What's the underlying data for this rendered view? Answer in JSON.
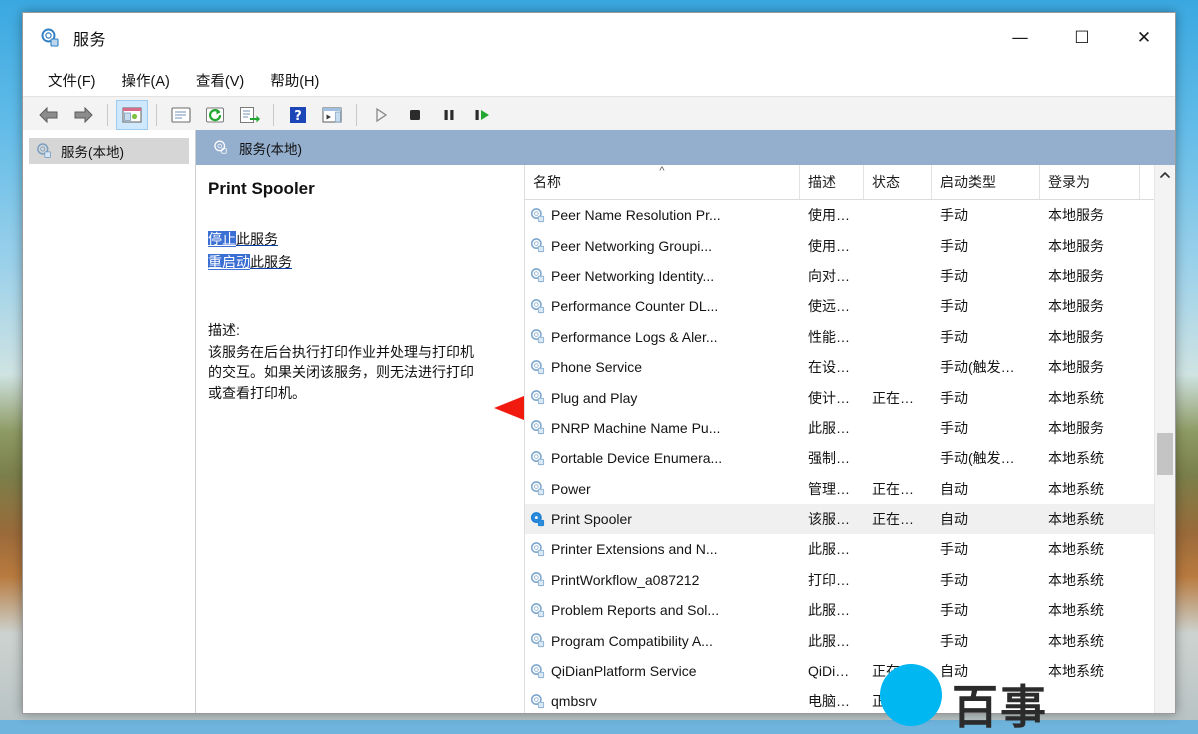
{
  "window": {
    "title": "服务",
    "app_icon": "services-gear-icon",
    "controls": {
      "minimize": "—",
      "maximize": "☐",
      "close": "✕",
      "minimize_name": "minimize-button",
      "maximize_name": "maximize-button",
      "close_name": "close-button"
    }
  },
  "menubar": {
    "items": [
      {
        "label": "文件(F)",
        "name": "menu-file"
      },
      {
        "label": "操作(A)",
        "name": "menu-action"
      },
      {
        "label": "查看(V)",
        "name": "menu-view"
      },
      {
        "label": "帮助(H)",
        "name": "menu-help"
      }
    ]
  },
  "toolbar": {
    "buttons": [
      {
        "name": "back-icon",
        "kind": "back"
      },
      {
        "name": "forward-icon",
        "kind": "forward"
      },
      {
        "name": "separator",
        "kind": "sep"
      },
      {
        "name": "show-hide-console-tree-icon",
        "kind": "tree",
        "active": true
      },
      {
        "name": "separator",
        "kind": "sep"
      },
      {
        "name": "properties-icon",
        "kind": "properties"
      },
      {
        "name": "refresh-icon",
        "kind": "refresh"
      },
      {
        "name": "export-list-icon",
        "kind": "export"
      },
      {
        "name": "separator",
        "kind": "sep"
      },
      {
        "name": "help-icon",
        "kind": "help"
      },
      {
        "name": "show-action-pane-icon",
        "kind": "actionpane"
      },
      {
        "name": "separator",
        "kind": "sep"
      },
      {
        "name": "start-service-icon",
        "kind": "play"
      },
      {
        "name": "stop-service-icon",
        "kind": "stop"
      },
      {
        "name": "pause-service-icon",
        "kind": "pause"
      },
      {
        "name": "restart-service-icon",
        "kind": "restart"
      }
    ]
  },
  "tree": {
    "root_label": "服务(本地)",
    "root_icon": "services-gear-icon"
  },
  "pane": {
    "header_label": "服务(本地)",
    "header_icon": "services-gear-icon",
    "header_color": "#94aece"
  },
  "details": {
    "service_title": "Print Spooler",
    "links": [
      {
        "name": "stop-service-link",
        "highlight": "停止",
        "rest": "此服务"
      },
      {
        "name": "restart-service-link",
        "highlight": "重启动",
        "rest": "此服务"
      }
    ],
    "description_heading": "描述:",
    "description_body": "该服务在后台执行打印作业并处理与打印机的交互。如果关闭该服务，则无法进行打印或查看打印机。"
  },
  "annotation": {
    "arrow_color": "#f01b0e",
    "name": "red-pointer-arrow",
    "points_to": "stop-service-link"
  },
  "list": {
    "columns": [
      {
        "key": "name",
        "label": "名称",
        "sorted": "asc",
        "cls": "c-name"
      },
      {
        "key": "desc",
        "label": "描述",
        "cls": "c-desc"
      },
      {
        "key": "state",
        "label": "状态",
        "cls": "c-state"
      },
      {
        "key": "start",
        "label": "启动类型",
        "cls": "c-start"
      },
      {
        "key": "logon",
        "label": "登录为",
        "cls": "c-logon"
      }
    ],
    "sort_indicator": "^",
    "rows": [
      {
        "name": "Peer Name Resolution Pr...",
        "desc": "使用…",
        "state": "",
        "start": "手动",
        "logon": "本地服务",
        "selected": false
      },
      {
        "name": "Peer Networking Groupi...",
        "desc": "使用…",
        "state": "",
        "start": "手动",
        "logon": "本地服务",
        "selected": false
      },
      {
        "name": "Peer Networking Identity...",
        "desc": "向对…",
        "state": "",
        "start": "手动",
        "logon": "本地服务",
        "selected": false
      },
      {
        "name": "Performance Counter DL...",
        "desc": "使远…",
        "state": "",
        "start": "手动",
        "logon": "本地服务",
        "selected": false
      },
      {
        "name": "Performance Logs & Aler...",
        "desc": "性能…",
        "state": "",
        "start": "手动",
        "logon": "本地服务",
        "selected": false
      },
      {
        "name": "Phone Service",
        "desc": "在设…",
        "state": "",
        "start": "手动(触发…",
        "logon": "本地服务",
        "selected": false
      },
      {
        "name": "Plug and Play",
        "desc": "使计…",
        "state": "正在…",
        "start": "手动",
        "logon": "本地系统",
        "selected": false
      },
      {
        "name": "PNRP Machine Name Pu...",
        "desc": "此服…",
        "state": "",
        "start": "手动",
        "logon": "本地服务",
        "selected": false
      },
      {
        "name": "Portable Device Enumera...",
        "desc": "强制…",
        "state": "",
        "start": "手动(触发…",
        "logon": "本地系统",
        "selected": false
      },
      {
        "name": "Power",
        "desc": "管理…",
        "state": "正在…",
        "start": "自动",
        "logon": "本地系统",
        "selected": false
      },
      {
        "name": "Print Spooler",
        "desc": "该服…",
        "state": "正在…",
        "start": "自动",
        "logon": "本地系统",
        "selected": true
      },
      {
        "name": "Printer Extensions and N...",
        "desc": "此服…",
        "state": "",
        "start": "手动",
        "logon": "本地系统",
        "selected": false
      },
      {
        "name": "PrintWorkflow_a087212",
        "desc": "打印…",
        "state": "",
        "start": "手动",
        "logon": "本地系统",
        "selected": false
      },
      {
        "name": "Problem Reports and Sol...",
        "desc": "此服…",
        "state": "",
        "start": "手动",
        "logon": "本地系统",
        "selected": false
      },
      {
        "name": "Program Compatibility A...",
        "desc": "此服…",
        "state": "",
        "start": "手动",
        "logon": "本地系统",
        "selected": false
      },
      {
        "name": "QiDianPlatform Service",
        "desc": "QiDi…",
        "state": "正在…",
        "start": "自动",
        "logon": "本地系统",
        "selected": false
      },
      {
        "name": "qmbsrv",
        "desc": "电脑…",
        "state": "正…",
        "start": "",
        "logon": "",
        "selected": false
      }
    ]
  },
  "scrollbar": {
    "up_arrow": "^",
    "name": "list-vertical-scrollbar"
  },
  "watermark": {
    "text": "百事",
    "dot_color": "#00b7f1"
  }
}
